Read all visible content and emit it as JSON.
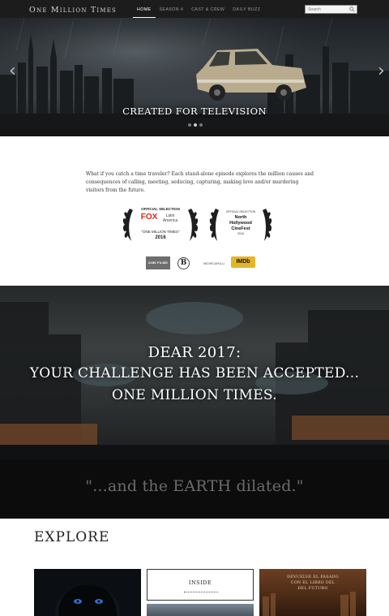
{
  "nav": {
    "logo": "One Million Times",
    "links": [
      {
        "label": "HOME",
        "active": true
      },
      {
        "label": "SEASON 4",
        "active": false
      },
      {
        "label": "CAST & CREW",
        "active": false
      },
      {
        "label": "DAILY BUZZ",
        "active": false
      }
    ],
    "search_placeholder": "Search"
  },
  "hero": {
    "caption": "CREATED FOR TELEVISION",
    "prev_arrow": "‹",
    "next_arrow": "›",
    "slide_count": 3,
    "active_slide": 1
  },
  "intro": {
    "text": "What if you catch a time traveler? Each stand-alone episode explores the million causes and consequences of calling, meeting, seducing, capturing, making love and/or murdering visitors from the future."
  },
  "awards": [
    {
      "line1": "OFFICIAL SELECTION",
      "brand": "FOX",
      "sub": "Latin",
      "sub2": "America",
      "title": "\"ONE MILLION TIMES\"",
      "year": "2016"
    },
    {
      "line1": "OFFICIAL SELECTION",
      "name1": "North",
      "name2": "Hollywood",
      "name3": "CineFest",
      "year": "2016"
    }
  ],
  "partners": {
    "first": "2286 FILMS",
    "second": "B",
    "third": "MICHECAPULLI",
    "imdb": "IMDb"
  },
  "dear": {
    "line1": "DEAR 2017:",
    "line2": "YOUR CHALLENGE HAS BEEN ACCEPTED...",
    "line3": "ONE MILLION TIMES."
  },
  "quote": "\"...and the EARTH dilated.\"",
  "explore": {
    "title": "EXPLORE",
    "inside_label": "INSIDE",
    "book_line1": "DEVUELVE EL PASADO",
    "book_line2": "CON EL LIBRO DEL",
    "book_line3": "DEL FUTURO"
  }
}
